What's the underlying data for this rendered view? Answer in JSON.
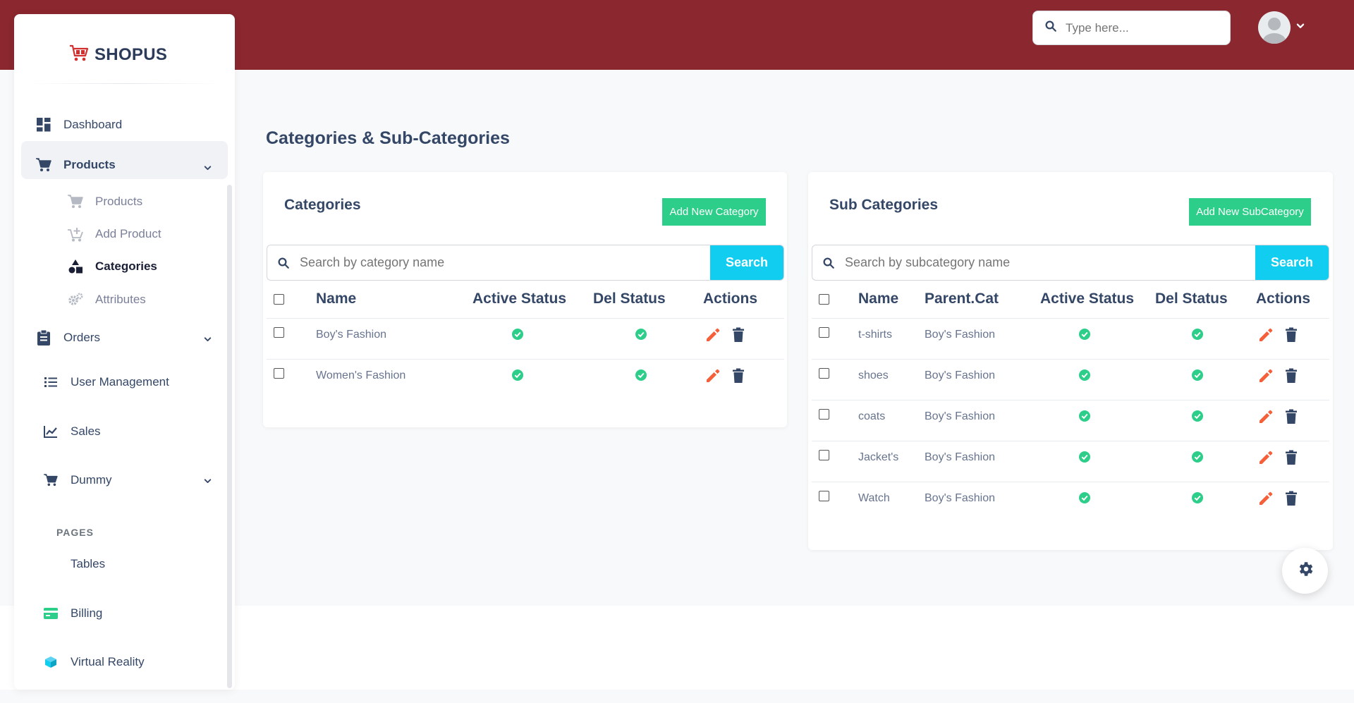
{
  "app": {
    "logo_text": "SHOPUS"
  },
  "header": {
    "search_placeholder": "Type here..."
  },
  "sidebar": {
    "dashboard": "Dashboard",
    "products": "Products",
    "sub_products": "Products",
    "sub_add_product": "Add Product",
    "sub_categories": "Categories",
    "sub_attributes": "Attributes",
    "orders": "Orders",
    "user_management": "User Management",
    "sales": "Sales",
    "dummy": "Dummy",
    "pages_label": "PAGES",
    "tables": "Tables",
    "billing": "Billing",
    "virtual_reality": "Virtual Reality"
  },
  "page": {
    "title": "Categories & Sub-Categories"
  },
  "categories": {
    "title": "Categories",
    "add_button": "Add New Category",
    "search_placeholder": "Search by category name",
    "search_button": "Search",
    "columns": {
      "name": "Name",
      "active": "Active Status",
      "del": "Del Status",
      "actions": "Actions"
    },
    "rows": [
      {
        "name": "Boy's Fashion"
      },
      {
        "name": "Women's Fashion"
      }
    ]
  },
  "subcategories": {
    "title": "Sub Categories",
    "add_button": "Add New SubCategory",
    "search_placeholder": "Search by subcategory name",
    "search_button": "Search",
    "columns": {
      "name": "Name",
      "parent": "Parent.Cat",
      "active": "Active Status",
      "del": "Del Status",
      "actions": "Actions"
    },
    "rows": [
      {
        "name": "t-shirts",
        "parent": "Boy's Fashion"
      },
      {
        "name": "shoes",
        "parent": "Boy's Fashion"
      },
      {
        "name": "coats",
        "parent": "Boy's Fashion"
      },
      {
        "name": "Jacket's",
        "parent": "Boy's Fashion"
      },
      {
        "name": "Watch",
        "parent": "Boy's Fashion"
      }
    ]
  },
  "colors": {
    "header": "#8a272f",
    "success": "#2dce89",
    "info": "#11cdef",
    "edit": "#f5603a",
    "delete": "#344767"
  }
}
